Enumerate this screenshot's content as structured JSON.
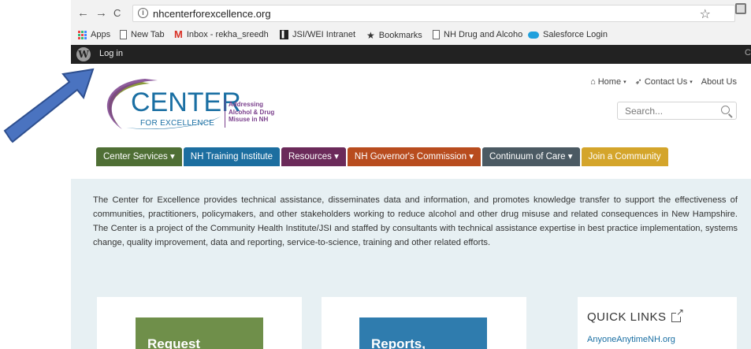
{
  "browser": {
    "back_icon": "←",
    "forward_icon": "→",
    "reload_icon": "C",
    "url": "nhcenterforexcellence.org",
    "star_icon": "☆",
    "bookmarks": [
      {
        "label": "Apps",
        "icon": "apps-icon"
      },
      {
        "label": "New Tab",
        "icon": "page-icon"
      },
      {
        "label": "Inbox - rekha_sreedh",
        "icon": "gmail-icon"
      },
      {
        "label": "JSI/WEI Intranet",
        "icon": "jsi-icon"
      },
      {
        "label": "Bookmarks",
        "icon": "star-icon"
      },
      {
        "label": "NH Drug and Alcoho",
        "icon": "page-icon"
      },
      {
        "label": "Salesforce Login",
        "icon": "cloud-icon"
      }
    ]
  },
  "wpbar": {
    "login_label": "Log in",
    "right_text": "C"
  },
  "header": {
    "logo_main": "CENTER",
    "logo_sub": "FOR EXCELLENCE",
    "logo_tagline_1": "Addressing",
    "logo_tagline_2": "Alcohol & Drug",
    "logo_tagline_3": "Misuse in NH",
    "toplinks": {
      "home": "Home",
      "contact": "Contact Us",
      "about": "About Us"
    },
    "search_placeholder": "Search..."
  },
  "mainnav": [
    {
      "label": "Center Services ▾",
      "color": "#4f6f35"
    },
    {
      "label": "NH Training Institute",
      "color": "#1c6ea0"
    },
    {
      "label": "Resources ▾",
      "color": "#6b2a5a"
    },
    {
      "label": "NH Governor's Commission ▾",
      "color": "#b84c1e"
    },
    {
      "label": "Continuum of Care ▾",
      "color": "#4b5a63"
    },
    {
      "label": "Join a Community",
      "color": "#d4a52b"
    }
  ],
  "main": {
    "intro": "The Center for Excellence provides technical assistance, disseminates data and information, and promotes knowledge transfer to support the effectiveness of communities, practitioners, policymakers, and other stakeholders working to reduce alcohol and other drug misuse and related consequences in New Hampshire. The Center is a project of the Community Health Institute/JSI and staffed by consultants with technical assistance expertise in best practice implementation, systems change, quality improvement, data and reporting, service-to-science, training and other related efforts.",
    "card1_title": "Request",
    "card2_title": "Reports,",
    "quicklinks_title": "QUICK LINKS",
    "quicklinks_item": "AnyoneAnytimeNH.org"
  },
  "colors": {
    "accent": "#1a6fa3",
    "annotation_arrow": "#4a73c0"
  }
}
